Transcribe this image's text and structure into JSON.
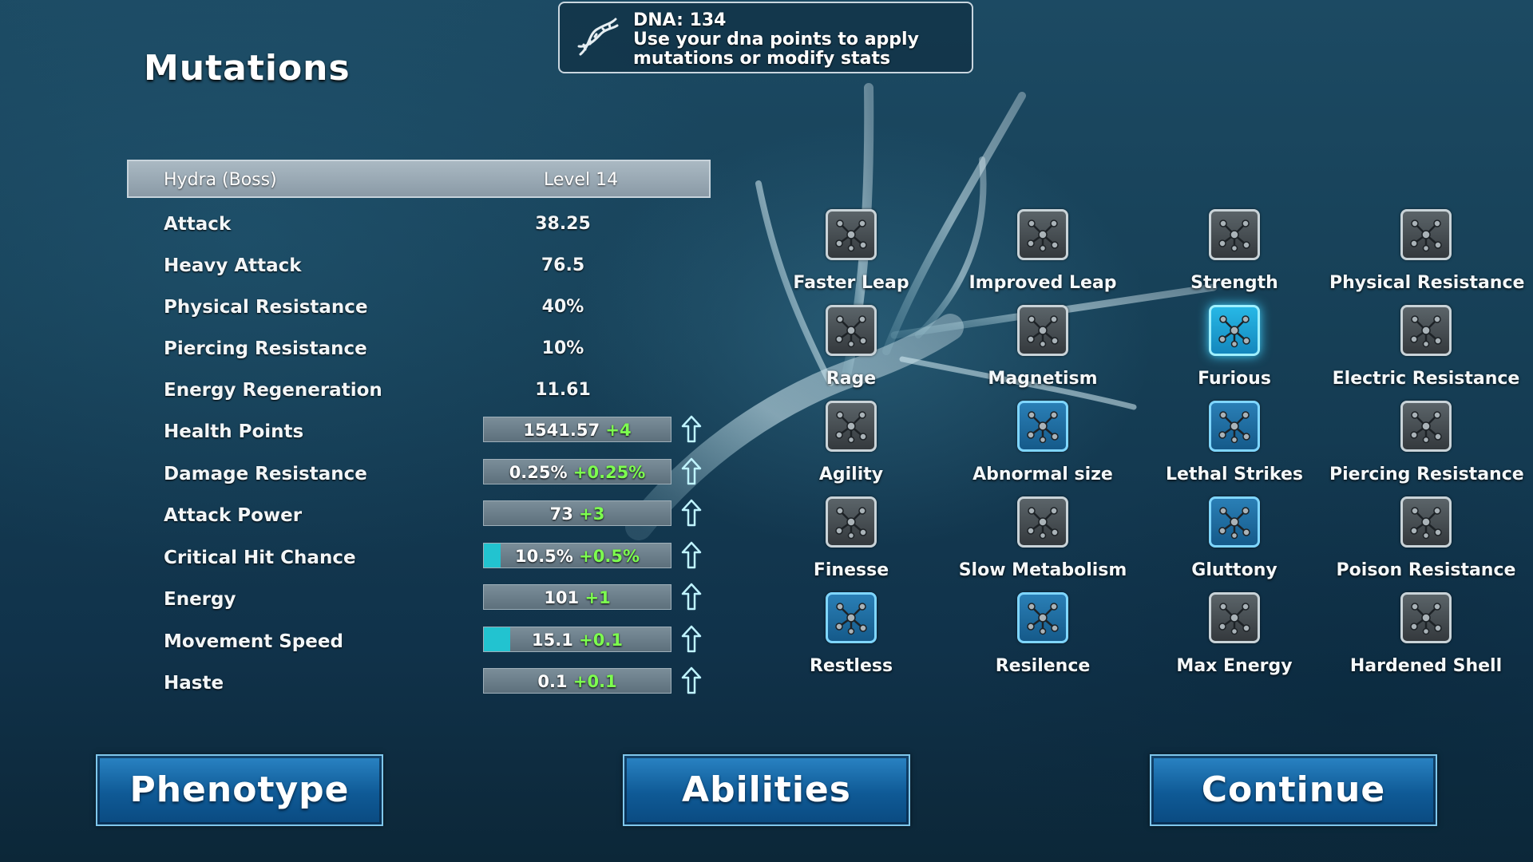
{
  "dna_box": {
    "icon": "dna-icon",
    "title": "DNA: 134",
    "hint_line1": "Use your dna points to apply",
    "hint_line2": "mutations or modify stats"
  },
  "page_title": "Mutations",
  "creature": {
    "name": "Hydra (Boss)",
    "level": "Level 14"
  },
  "fixed_stats": [
    {
      "label": "Attack",
      "value": "38.25"
    },
    {
      "label": "Heavy Attack",
      "value": "76.5"
    },
    {
      "label": "Physical Resistance",
      "value": "40%"
    },
    {
      "label": "Piercing Resistance",
      "value": "10%"
    },
    {
      "label": "Energy Regeneration",
      "value": "11.61"
    }
  ],
  "upgradable_stats": [
    {
      "label": "Health Points",
      "base": "1541.57",
      "bonus": "+4",
      "progress": 0
    },
    {
      "label": "Damage Resistance",
      "base": "0.25%",
      "bonus": "+0.25%",
      "progress": 0
    },
    {
      "label": "Attack Power",
      "base": "73",
      "bonus": "+3",
      "progress": 0
    },
    {
      "label": "Critical Hit Chance",
      "base": "10.5%",
      "bonus": "+0.5%",
      "progress": 0.09
    },
    {
      "label": "Energy",
      "base": "101",
      "bonus": "+1",
      "progress": 0
    },
    {
      "label": "Movement Speed",
      "base": "15.1",
      "bonus": "+0.1",
      "progress": 0.14
    },
    {
      "label": "Haste",
      "base": "0.1",
      "bonus": "+0.1",
      "progress": 0
    }
  ],
  "mutations": [
    [
      {
        "label": "Faster Leap",
        "state": "locked"
      },
      {
        "label": "Improved Leap",
        "state": "locked"
      },
      {
        "label": "Strength",
        "state": "locked"
      },
      {
        "label": "Physical Resistance",
        "state": "locked"
      }
    ],
    [
      {
        "label": "Rage",
        "state": "locked"
      },
      {
        "label": "Magnetism",
        "state": "locked"
      },
      {
        "label": "Furious",
        "state": "selected"
      },
      {
        "label": "Electric Resistance",
        "state": "locked"
      }
    ],
    [
      {
        "label": "Agility",
        "state": "locked"
      },
      {
        "label": "Abnormal size",
        "state": "active"
      },
      {
        "label": "Lethal Strikes",
        "state": "active"
      },
      {
        "label": "Piercing Resistance",
        "state": "locked"
      }
    ],
    [
      {
        "label": "Finesse",
        "state": "locked"
      },
      {
        "label": "Slow Metabolism",
        "state": "locked"
      },
      {
        "label": "Gluttony",
        "state": "active"
      },
      {
        "label": "Poison Resistance",
        "state": "locked"
      }
    ],
    [
      {
        "label": "Restless",
        "state": "active"
      },
      {
        "label": "Resilence",
        "state": "active"
      },
      {
        "label": "Max Energy",
        "state": "locked"
      },
      {
        "label": "Hardened Shell",
        "state": "locked"
      }
    ]
  ],
  "buttons": {
    "phenotype": "Phenotype",
    "abilities": "Abilities",
    "continue": "Continue"
  },
  "colors": {
    "bonus_green": "#7dff4f",
    "progress_cyan": "#22c3d0",
    "active_mutation": "#2a7fb6",
    "selected_mutation": "#27b8e6"
  }
}
